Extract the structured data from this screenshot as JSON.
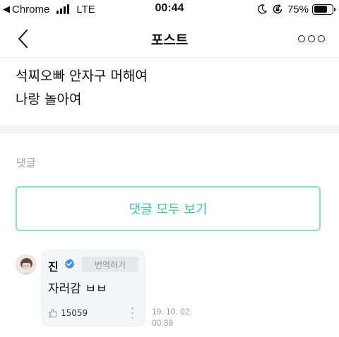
{
  "status_bar": {
    "back_glyph": "◀",
    "app_name": "Chrome",
    "network": "LTE",
    "time": "00:44",
    "battery_percent_label": "75%",
    "battery_level": 0.75
  },
  "nav": {
    "title": "포스트"
  },
  "post": {
    "line1": "석찌오빠 안자구 머해여",
    "line2": "나랑 놀아여"
  },
  "comments": {
    "label": "댓글",
    "view_all_label": "댓글 모두 보기",
    "items": [
      {
        "author": "진",
        "translate_label": "번역하기",
        "text": "자러감 ㅂㅂ",
        "likes": "15059",
        "time_date": "19. 10. 02.",
        "time_clock": "00:39"
      }
    ]
  },
  "colors": {
    "accent": "#3cc7a4",
    "accent_border": "#8ae0c9",
    "verified": "#3f8ef0"
  }
}
